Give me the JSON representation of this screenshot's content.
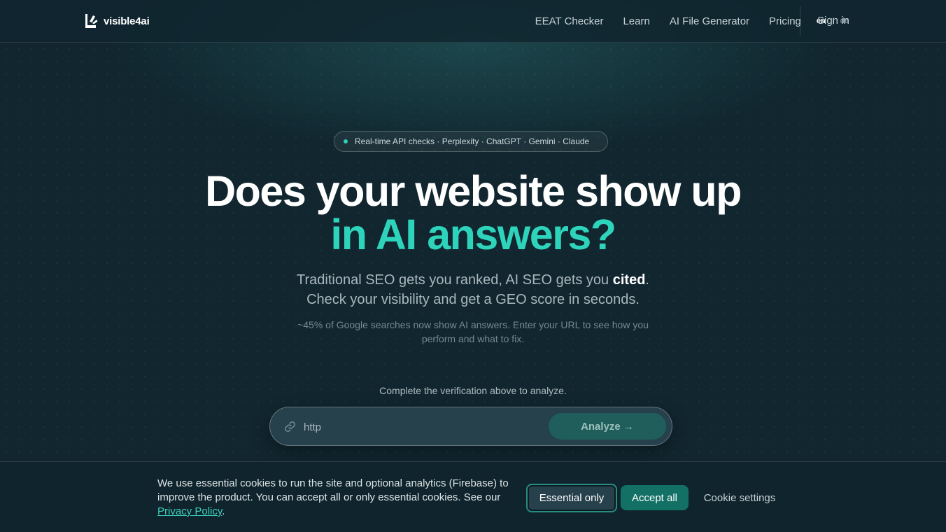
{
  "brand": {
    "name": "visible4ai",
    "icon": "logo-mark-icon"
  },
  "nav": {
    "items": [
      {
        "label": "EEAT Checker"
      },
      {
        "label": "Learn"
      },
      {
        "label": "AI File Generator"
      },
      {
        "label": "Pricing"
      }
    ],
    "languages": {
      "active": "en",
      "other": "de"
    },
    "signin_label": "Sign in"
  },
  "hero": {
    "badge": "Real-time API checks · Perplexity · ChatGPT · Gemini · Claude",
    "headline_line1": "Does your website show up",
    "headline_line2": "in AI answers?",
    "sub_part1": "Traditional SEO gets you ranked, AI SEO gets you ",
    "sub_bold": "cited",
    "sub_part2": ".",
    "sub_line2": "Check your visibility and get a GEO score in seconds.",
    "note": "~45% of Google searches now show AI answers. Enter your URL to see how you perform and what to fix.",
    "verify_text": "Complete the verification above to analyze."
  },
  "url_form": {
    "value": "http",
    "icon": "link-icon",
    "analyze_label": "Analyze →"
  },
  "cookie": {
    "text": "We use essential cookies to run the site and optional analytics (Firebase) to improve the product. You can accept all or only essential cookies. See our ",
    "privacy_link": "Privacy Policy",
    "text_end": ".",
    "essential_label": "Essential only",
    "accept_label": "Accept all",
    "settings_label": "Cookie settings"
  },
  "colors": {
    "background": "#11262f",
    "accent": "#2ed3bb",
    "button_primary": "#127065"
  }
}
